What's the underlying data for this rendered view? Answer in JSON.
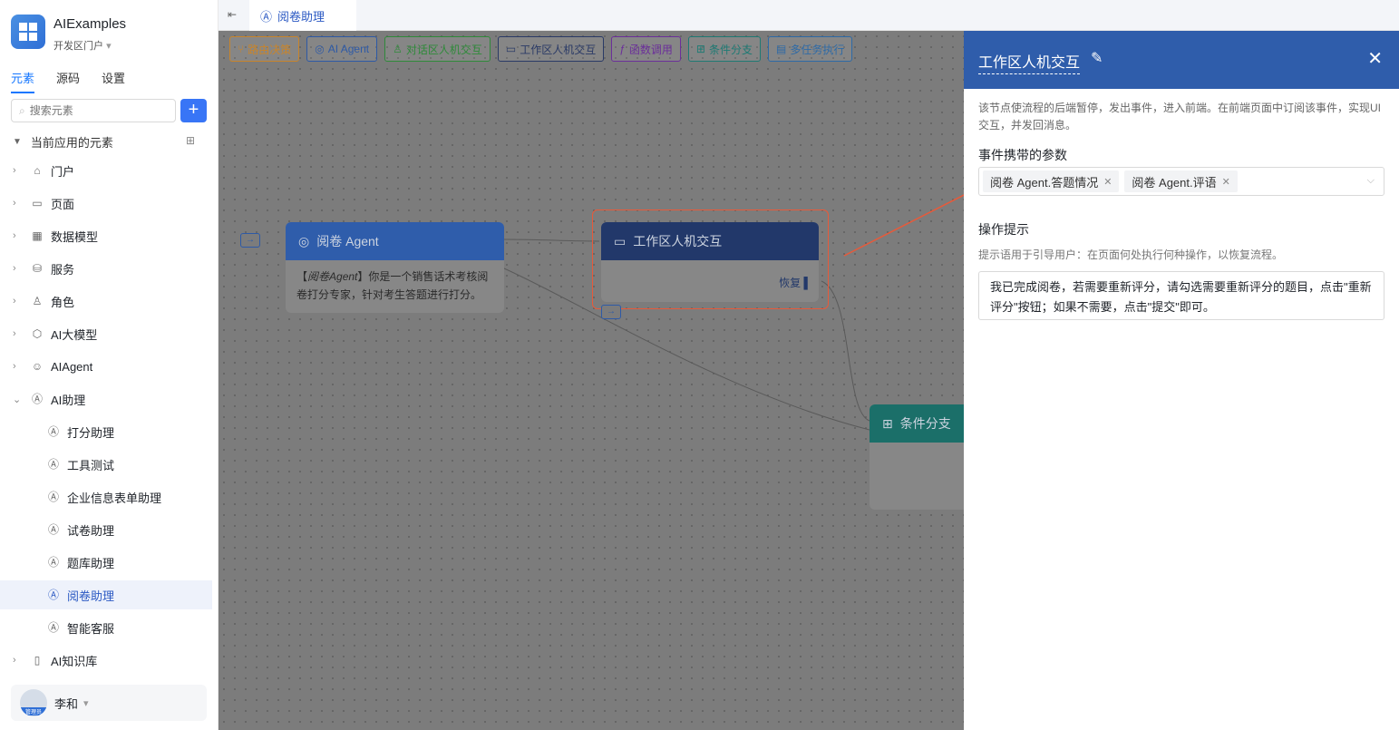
{
  "app": {
    "name": "AIExamples",
    "portal": "开发区门户"
  },
  "sidebar": {
    "tabs": [
      "元素",
      "源码",
      "设置"
    ],
    "search_placeholder": "搜索元素",
    "section_title": "当前应用的元素",
    "items": [
      {
        "label": "门户",
        "icon": "home-icon"
      },
      {
        "label": "页面",
        "icon": "page-icon"
      },
      {
        "label": "数据模型",
        "icon": "table-icon"
      },
      {
        "label": "服务",
        "icon": "service-icon"
      },
      {
        "label": "角色",
        "icon": "role-icon"
      },
      {
        "label": "AI大模型",
        "icon": "model-icon"
      },
      {
        "label": "AIAgent",
        "icon": "robot-icon"
      },
      {
        "label": "AI助理",
        "icon": "ai-icon"
      }
    ],
    "children": [
      "打分助理",
      "工具测试",
      "企业信息表单助理",
      "试卷助理",
      "题库助理",
      "阅卷助理",
      "智能客服"
    ],
    "last_item": "AI知识库",
    "user": {
      "name": "李和",
      "badge": "管理员"
    }
  },
  "topbar": {
    "tab": "阅卷助理"
  },
  "toolbar": [
    {
      "label": "路由决策",
      "color": "#c9852b"
    },
    {
      "label": "AI Agent",
      "color": "#2e5aa6"
    },
    {
      "label": "对话区人机交互",
      "color": "#2f8a3a"
    },
    {
      "label": "工作区人机交互",
      "color": "#2a3a66"
    },
    {
      "label": "函数调用",
      "color": "#6b2f9a"
    },
    {
      "label": "条件分支",
      "color": "#1f7a74"
    },
    {
      "label": "多任务执行",
      "color": "#2e6aa6"
    }
  ],
  "nodes": {
    "agent": {
      "title": "阅卷 Agent",
      "body_em": "阅卷Agent",
      "body": "你是一个销售话术考核阅卷打分专家，针对考生答题进行打分。"
    },
    "workspace": {
      "title": "工作区人机交互",
      "port_label": "恢复"
    },
    "branch": {
      "title": "条件分支"
    }
  },
  "panel": {
    "title": "工作区人机交互",
    "description": "该节点使流程的后端暂停，发出事件，进入前端。在前端页面中订阅该事件，实现UI交互，并发回消息。",
    "params_label": "事件携带的参数",
    "params": [
      "阅卷 Agent.答题情况",
      "阅卷 Agent.评语"
    ],
    "hint_label": "操作提示",
    "hint_desc": "提示语用于引导用户：在页面何处执行何种操作，以恢复流程。",
    "hint_text": "我已完成阅卷，若需要重新评分，请勾选需要重新评分的题目，点击\"重新评分\"按钮；如果不需要，点击\"提交\"即可。"
  }
}
